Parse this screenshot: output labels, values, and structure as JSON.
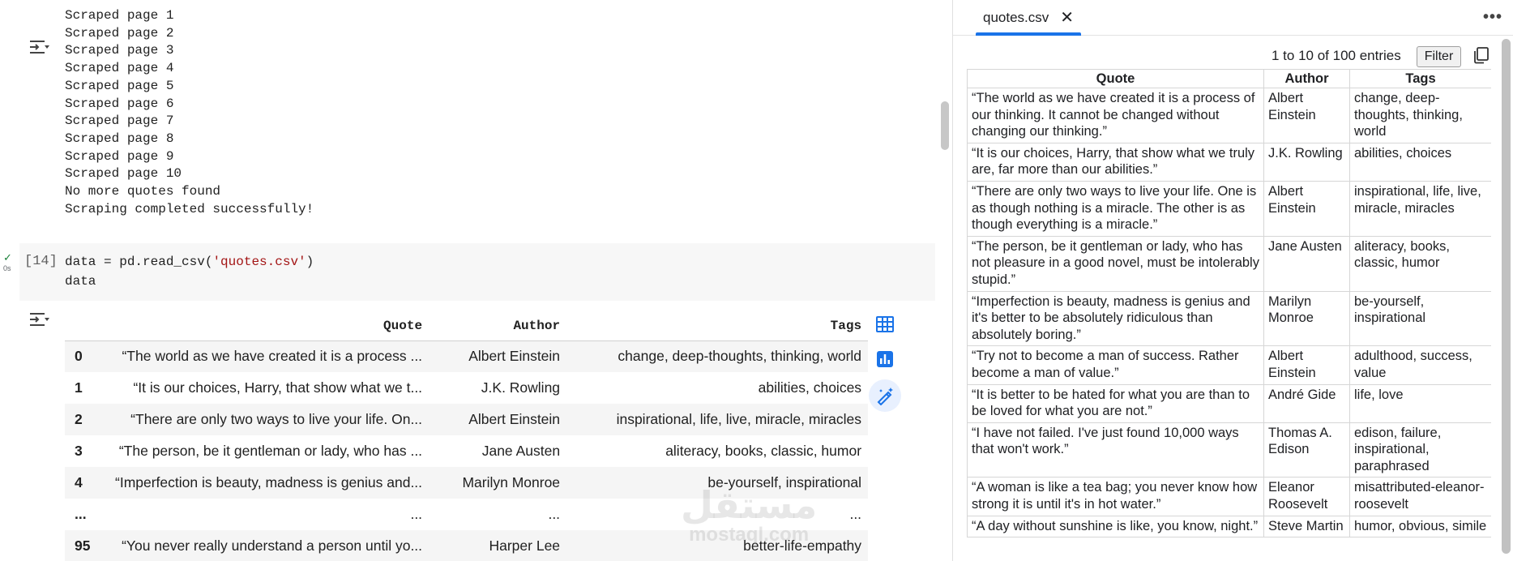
{
  "notebook": {
    "scrape_log": [
      "Scraped page 1",
      "Scraped page 2",
      "Scraped page 3",
      "Scraped page 4",
      "Scraped page 5",
      "Scraped page 6",
      "Scraped page 7",
      "Scraped page 8",
      "Scraped page 9",
      "Scraped page 10",
      "No more quotes found",
      "Scraping completed successfully!"
    ],
    "cell": {
      "exec_count": "[14]",
      "run_status": "✓",
      "run_time": "0s",
      "code_line1_pre": "data = pd.read_csv(",
      "code_line1_str": "'quotes.csv'",
      "code_line1_post": ")",
      "code_line2": "data"
    },
    "dataframe": {
      "columns": [
        "",
        "Quote",
        "Author",
        "Tags"
      ],
      "rows": [
        {
          "idx": "0",
          "quote": "“The world as we have created it is a process ...",
          "author": "Albert Einstein",
          "tags": "change, deep-thoughts, thinking, world"
        },
        {
          "idx": "1",
          "quote": "“It is our choices, Harry, that show what we t...",
          "author": "J.K. Rowling",
          "tags": "abilities, choices"
        },
        {
          "idx": "2",
          "quote": "“There are only two ways to live your life. On...",
          "author": "Albert Einstein",
          "tags": "inspirational, life, live, miracle, miracles"
        },
        {
          "idx": "3",
          "quote": "“The person, be it gentleman or lady, who has ...",
          "author": "Jane Austen",
          "tags": "aliteracy, books, classic, humor"
        },
        {
          "idx": "4",
          "quote": "“Imperfection is beauty, madness is genius and...",
          "author": "Marilyn Monroe",
          "tags": "be-yourself, inspirational"
        },
        {
          "idx": "...",
          "quote": "...",
          "author": "...",
          "tags": "..."
        },
        {
          "idx": "95",
          "quote": "“You never really understand a person until yo...",
          "author": "Harper Lee",
          "tags": "better-life-empathy"
        }
      ]
    },
    "watermark": {
      "arabic": "مستقل",
      "latin": "mostaql.com"
    }
  },
  "panel": {
    "tab_label": "quotes.csv",
    "entries_text": "1 to 10 of 100 entries",
    "filter_label": "Filter",
    "columns": [
      "Quote",
      "Author",
      "Tags"
    ],
    "rows": [
      {
        "quote": "“The world as we have created it is a process of our thinking. It cannot be changed without changing our thinking.”",
        "author": "Albert Einstein",
        "tags": "change, deep-thoughts, thinking, world"
      },
      {
        "quote": "“It is our choices, Harry, that show what we truly are, far more than our abilities.”",
        "author": "J.K. Rowling",
        "tags": "abilities, choices"
      },
      {
        "quote": "“There are only two ways to live your life. One is as though nothing is a miracle. The other is as though everything is a miracle.”",
        "author": "Albert Einstein",
        "tags": "inspirational, life, live, miracle, miracles"
      },
      {
        "quote": "“The person, be it gentleman or lady, who has not pleasure in a good novel, must be intolerably stupid.”",
        "author": "Jane Austen",
        "tags": "aliteracy, books, classic, humor"
      },
      {
        "quote": "“Imperfection is beauty, madness is genius and it's better to be absolutely ridiculous than absolutely boring.”",
        "author": "Marilyn Monroe",
        "tags": "be-yourself, inspirational"
      },
      {
        "quote": "“Try not to become a man of success. Rather become a man of value.”",
        "author": "Albert Einstein",
        "tags": "adulthood, success, value"
      },
      {
        "quote": "“It is better to be hated for what you are than to be loved for what you are not.”",
        "author": "André Gide",
        "tags": "life, love"
      },
      {
        "quote": "“I have not failed. I've just found 10,000 ways that won't work.”",
        "author": "Thomas A. Edison",
        "tags": "edison, failure, inspirational, paraphrased"
      },
      {
        "quote": "“A woman is like a tea bag; you never know how strong it is until it's in hot water.”",
        "author": "Eleanor Roosevelt",
        "tags": "misattributed-eleanor-roosevelt"
      },
      {
        "quote": "“A day without sunshine is like, you know, night.”",
        "author": "Steve Martin",
        "tags": "humor, obvious, simile"
      }
    ]
  },
  "icons": {
    "output_toggle": "output-collapse-icon",
    "table_view": "table-icon",
    "chart": "bar-chart-icon",
    "magic": "magic-wand-icon",
    "copy": "copy-icon",
    "close": "close-icon",
    "more": "more-options-icon"
  },
  "colors": {
    "accent": "#1a73e8",
    "string": "#a31515",
    "success": "#188038"
  }
}
